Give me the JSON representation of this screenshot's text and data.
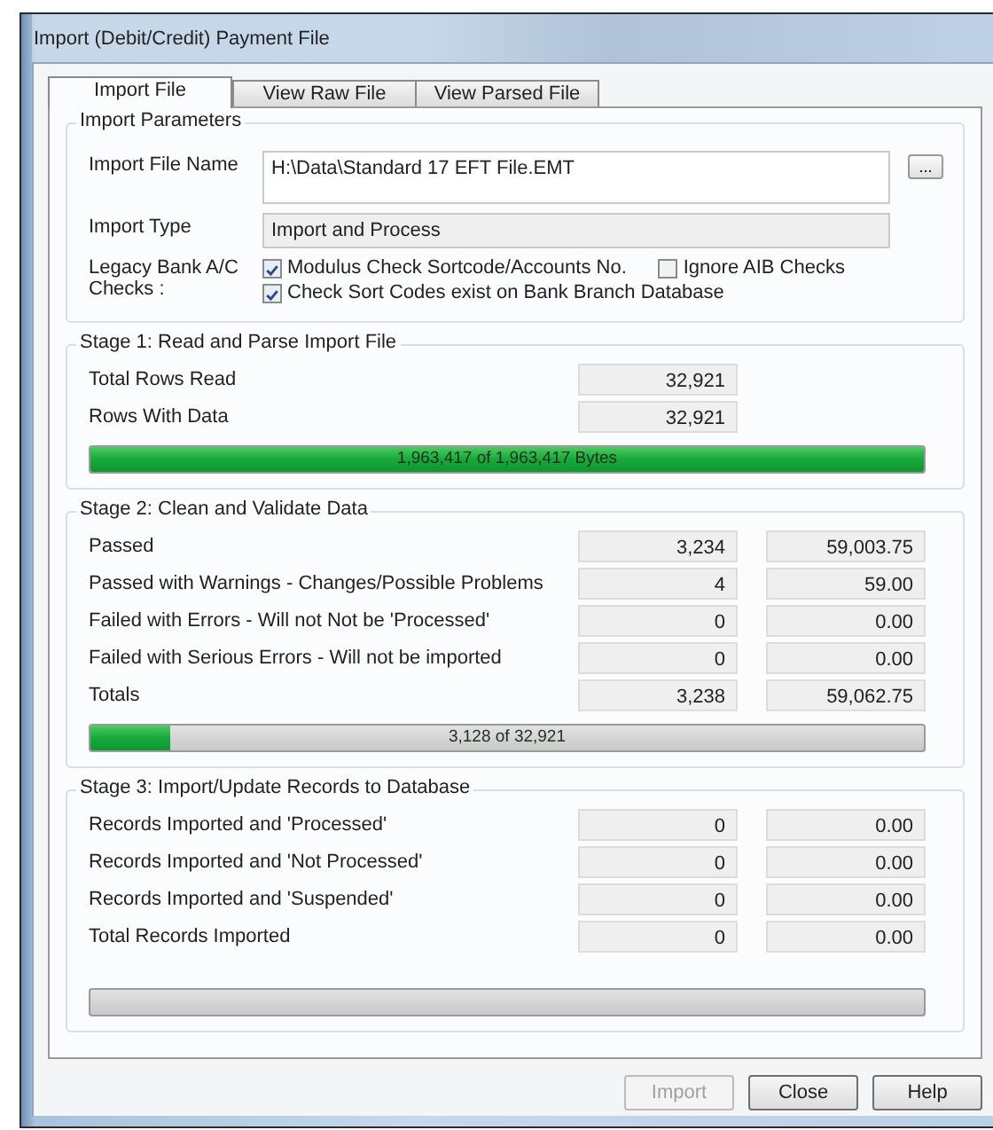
{
  "window": {
    "title": "Import (Debit/Credit) Payment File"
  },
  "tabs": [
    {
      "label": "Import File",
      "selected": true
    },
    {
      "label": "View Raw File",
      "selected": false
    },
    {
      "label": "View Parsed File",
      "selected": false
    }
  ],
  "import_parameters": {
    "title": "Import Parameters",
    "file_name": {
      "label": "Import File Name",
      "value": "H:\\Data\\Standard 17 EFT File.EMT"
    },
    "browse_button": "...",
    "import_type": {
      "label": "Import Type",
      "value": "Import and Process"
    },
    "checks_label": "Legacy Bank A/C Checks :",
    "checkbox_rows": [
      [
        {
          "label": "Modulus Check Sortcode/Accounts No.",
          "checked": true
        },
        {
          "label": "Ignore AIB Checks",
          "checked": false
        }
      ],
      [
        {
          "label": "Check Sort Codes exist on Bank Branch Database",
          "checked": true
        }
      ]
    ]
  },
  "stages": [
    {
      "title": "Stage 1: Read and Parse Import File",
      "rows": [
        {
          "label": "Total Rows Read",
          "values": [
            "32,921"
          ]
        },
        {
          "label": "Rows With Data",
          "values": [
            "32,921"
          ]
        }
      ],
      "progress": {
        "text": "1,963,417 of 1,963,417 Bytes",
        "level": 1
      }
    },
    {
      "title": "Stage 2:  Clean and Validate Data",
      "rows": [
        {
          "label": "Passed",
          "values": [
            "3,234",
            "59,003.75"
          ]
        },
        {
          "label": "Passed with Warnings - Changes/Possible Problems",
          "values": [
            "4",
            "59.00"
          ]
        },
        {
          "label": "Failed with Errors - Will not Not be 'Processed'",
          "values": [
            "0",
            "0.00"
          ]
        },
        {
          "label": "Failed with Serious Errors - Will not be imported",
          "values": [
            "0",
            "0.00"
          ]
        },
        {
          "label": "Totals",
          "values": [
            "3,238",
            "59,062.75"
          ]
        }
      ],
      "progress": {
        "text": "3,128 of 32,921",
        "level": 0.095
      }
    },
    {
      "title": "Stage 3:  Import/Update Records to Database",
      "rows": [
        {
          "label": "Records Imported and 'Processed'",
          "values": [
            "0",
            "0.00"
          ]
        },
        {
          "label": "Records Imported and 'Not Processed'",
          "values": [
            "0",
            "0.00"
          ]
        },
        {
          "label": "Records Imported and 'Suspended'",
          "values": [
            "0",
            "0.00"
          ]
        },
        {
          "label": "Total Records Imported",
          "values": [
            "0",
            "0.00"
          ]
        }
      ],
      "progress": {
        "level": 0
      }
    }
  ],
  "buttons": [
    {
      "label": "Import",
      "disabled": true
    },
    {
      "label": "Close",
      "disabled": false
    },
    {
      "label": "Help",
      "disabled": false
    }
  ]
}
